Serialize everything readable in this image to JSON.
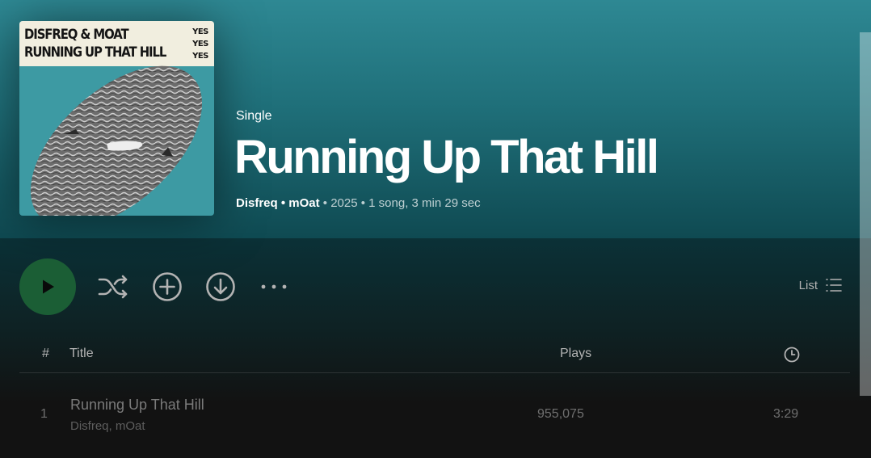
{
  "album": {
    "type": "Single",
    "title": "Running Up That Hill",
    "artists": "Disfreq • mOat",
    "year": "2025",
    "summary": "1 song, 3 min 29 sec"
  },
  "cover": {
    "title_line1": "DISFREQ & MOAT",
    "title_line2": "RUNNING UP THAT HILL",
    "badge_lines": [
      "YES",
      "YES",
      "YES"
    ]
  },
  "controls": {
    "view_label": "List"
  },
  "tracklist": {
    "headers": {
      "number": "#",
      "title": "Title",
      "plays": "Plays"
    },
    "tracks": [
      {
        "number": "1",
        "title": "Running Up That Hill",
        "artists": "Disfreq, mOat",
        "plays": "955,075",
        "duration": "3:29"
      }
    ]
  },
  "colors": {
    "header_teal": "#2e8893",
    "play_green": "#1b5e35",
    "cover_cream": "#f1eedf",
    "cover_teal": "#3d9aa3"
  },
  "icons": [
    "play-icon",
    "shuffle-icon",
    "add-icon",
    "download-icon",
    "more-icon",
    "list-view-icon",
    "clock-icon"
  ]
}
